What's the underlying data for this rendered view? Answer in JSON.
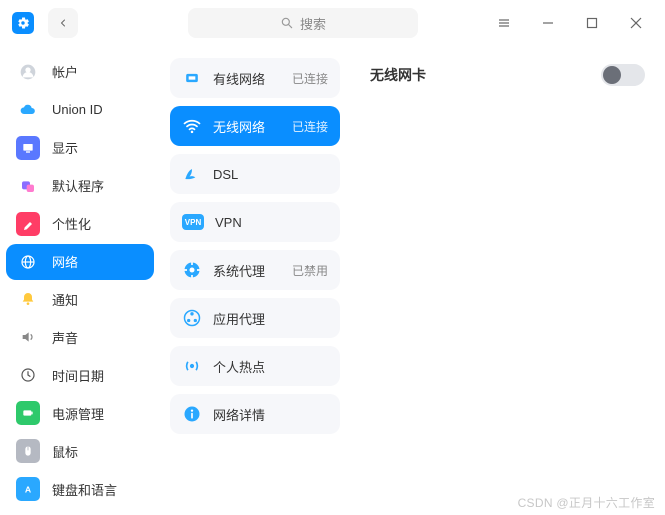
{
  "search": {
    "placeholder": "搜索"
  },
  "sidebar": {
    "items": [
      {
        "label": "帐户"
      },
      {
        "label": "Union ID"
      },
      {
        "label": "显示"
      },
      {
        "label": "默认程序"
      },
      {
        "label": "个性化"
      },
      {
        "label": "网络"
      },
      {
        "label": "通知"
      },
      {
        "label": "声音"
      },
      {
        "label": "时间日期"
      },
      {
        "label": "电源管理"
      },
      {
        "label": "鼠标"
      },
      {
        "label": "键盘和语言"
      }
    ]
  },
  "network": {
    "items": [
      {
        "label": "有线网络",
        "status": "已连接"
      },
      {
        "label": "无线网络",
        "status": "已连接"
      },
      {
        "label": "DSL",
        "status": ""
      },
      {
        "label": "VPN",
        "status": ""
      },
      {
        "label": "系统代理",
        "status": "已禁用"
      },
      {
        "label": "应用代理",
        "status": ""
      },
      {
        "label": "个人热点",
        "status": ""
      },
      {
        "label": "网络详情",
        "status": ""
      }
    ]
  },
  "detail": {
    "title": "无线网卡",
    "toggle_on": false
  },
  "watermark": "CSDN @正月十六工作室"
}
